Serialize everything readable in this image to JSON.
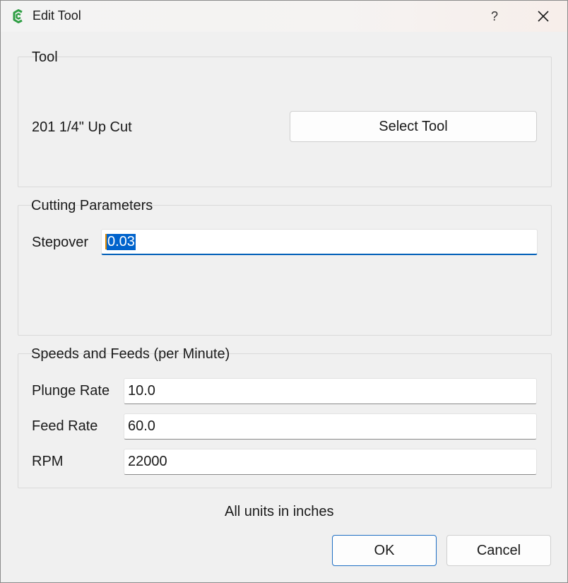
{
  "window": {
    "title": "Edit Tool",
    "help_label": "?",
    "icons": {
      "app": "app-logo-icon",
      "close": "close-icon"
    }
  },
  "tool_group": {
    "title": "Tool",
    "tool_name": "201 1/4\" Up Cut",
    "select_button": "Select Tool"
  },
  "cutting_group": {
    "title": "Cutting Parameters",
    "stepover_label": "Stepover",
    "stepover_value": "0.03"
  },
  "speeds_group": {
    "title": "Speeds and Feeds (per Minute)",
    "plunge_label": "Plunge Rate",
    "plunge_value": "10.0",
    "feed_label": "Feed Rate",
    "feed_value": "60.0",
    "rpm_label": "RPM",
    "rpm_value": "22000"
  },
  "footer": {
    "units_note": "All units in inches",
    "ok": "OK",
    "cancel": "Cancel"
  },
  "colors": {
    "accent": "#005fb8",
    "selection": "#0063cc",
    "app_icon": "#2f9e44"
  }
}
